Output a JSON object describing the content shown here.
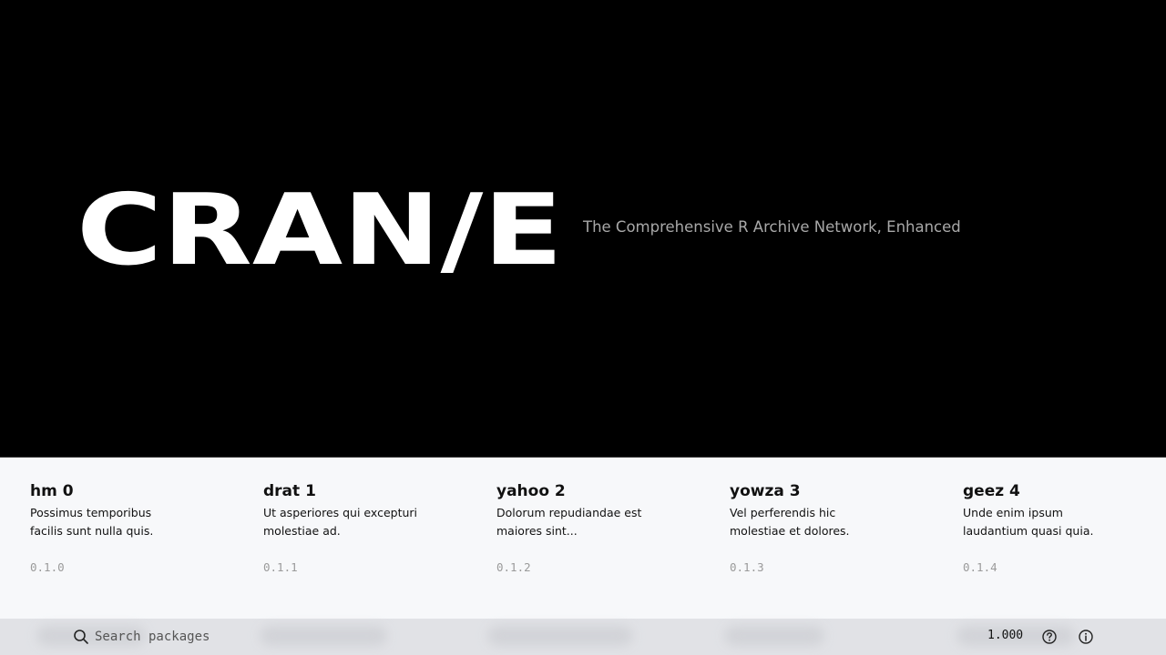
{
  "hero": {
    "logo_text": "CRAN/E",
    "tagline": "The Comprehensive R Archive Network, Enhanced",
    "background": "#000000"
  },
  "packages": [
    {
      "name": "hm 0",
      "description": "Possimus temporibus facilis sunt nulla quis.",
      "version": "0.1.0"
    },
    {
      "name": "drat 1",
      "description": "Ut asperiores qui excepturi molestiae ad.",
      "version": "0.1.1"
    },
    {
      "name": "yahoo 2",
      "description": "Dolorum repudiandae est maiores sint...",
      "version": "0.1.2"
    },
    {
      "name": "yowza 3",
      "description": "Vel perferendis hic molestiae et dolores.",
      "version": "0.1.3"
    },
    {
      "name": "geez 4",
      "description": "Unde enim ipsum laudantium quasi quia.",
      "version": "0.1.4"
    }
  ],
  "bottom_bar": {
    "search_placeholder": "Search packages",
    "search_value": "",
    "count": "1.000",
    "help_icon": "question-circle-icon",
    "info_icon": "info-circle-icon"
  }
}
